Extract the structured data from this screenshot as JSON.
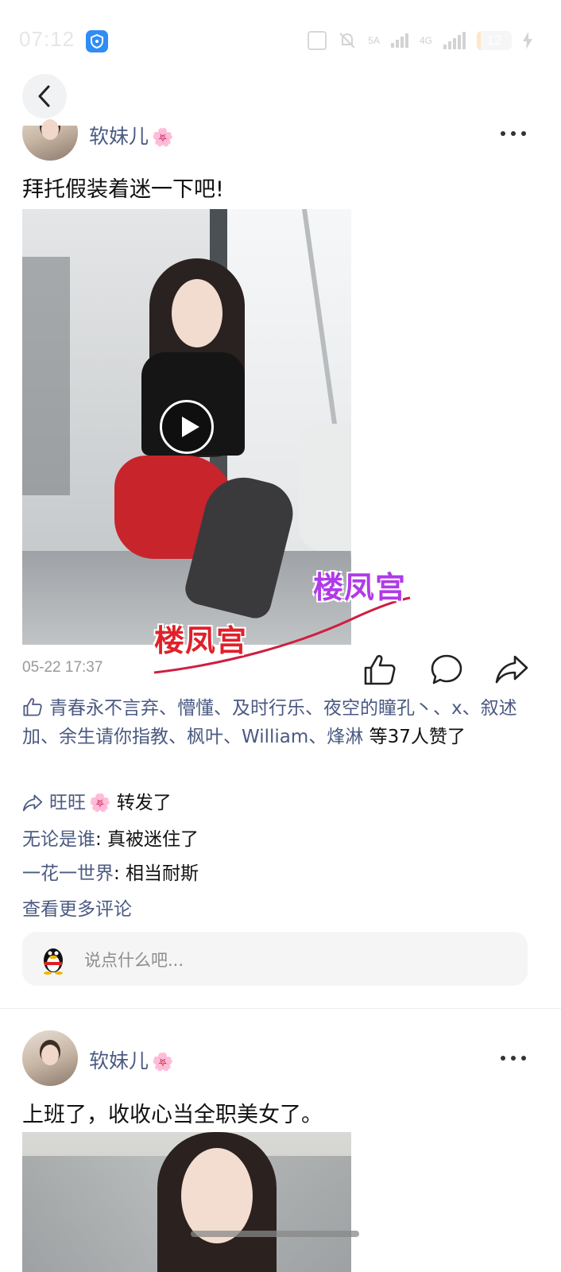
{
  "status_bar": {
    "time": "07:12",
    "battery_level": "12",
    "battery_fraction": 0.12,
    "net_label_1": "5A",
    "net_label_2": "4G",
    "icons": [
      "nfc-icon",
      "mute-icon",
      "signal-icon",
      "signal-icon",
      "battery-icon",
      "charging-icon"
    ]
  },
  "nav": {
    "back_icon": "chevron-left-icon"
  },
  "posts": [
    {
      "username": "软妹儿",
      "user_emoji": "🌸",
      "text": "拜托假装着迷一下吧!",
      "media_type": "video",
      "watermark_1": "楼凤宫",
      "watermark_2": "楼凤宫",
      "timestamp": "05-22 17:37",
      "likes": {
        "names": "青春永不言弃、懵懂、及时行乐、夜空的瞳孔丶、x、叙述加、余生请你指教、枫叶、William、烽淋",
        "suffix": " 等37人赞了"
      },
      "repost": {
        "user": "旺旺",
        "user_emoji": "🌸",
        "action": " 转发了"
      },
      "comments": [
        {
          "user": "无论是谁",
          "text": ": 真被迷住了"
        },
        {
          "user": "一花一世界",
          "text": ": 相当耐斯"
        }
      ],
      "more_comments": "查看更多评论",
      "comment_placeholder": "说点什么吧..."
    },
    {
      "username": "软妹儿",
      "user_emoji": "🌸",
      "text": "上班了，收收心当全职美女了。",
      "media_type": "image"
    }
  ],
  "colors": {
    "link": "#4b5a82",
    "accent_watermark_red": "#e0202a",
    "accent_watermark_purple": "#b03ae8"
  }
}
